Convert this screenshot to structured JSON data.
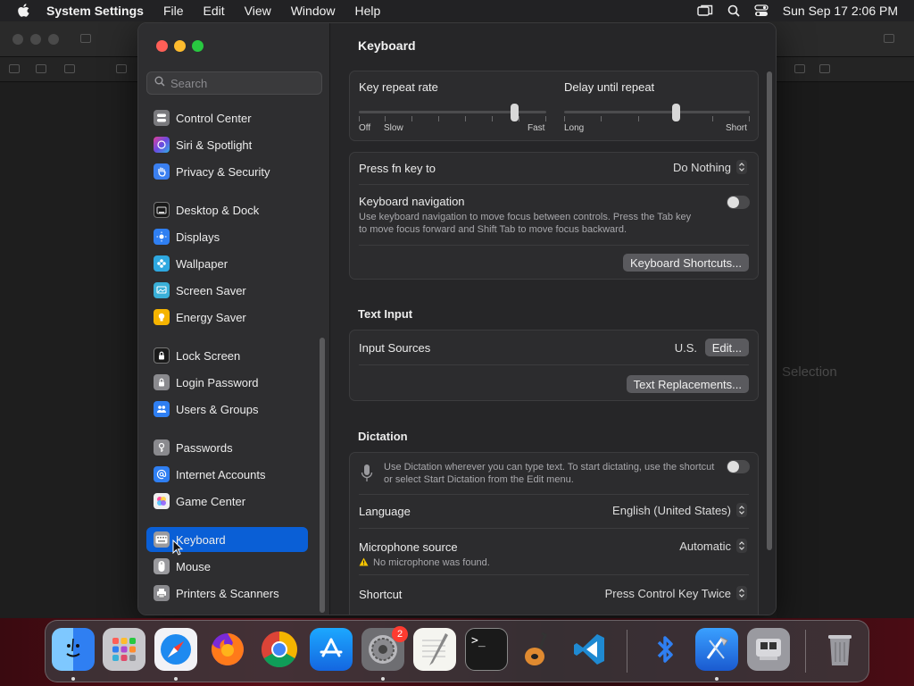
{
  "menubar": {
    "app_name": "System Settings",
    "items": [
      "File",
      "Edit",
      "View",
      "Window",
      "Help"
    ],
    "clock": "Sun Sep 17  2:06 PM"
  },
  "background_window": {
    "placeholder": "Selection"
  },
  "sidebar": {
    "search_placeholder": "Search",
    "items": [
      {
        "label": "Control Center",
        "icon": "control-center-icon",
        "color": "#7a7a7e"
      },
      {
        "label": "Siri & Spotlight",
        "icon": "siri-icon",
        "color": "#b04ad0"
      },
      {
        "label": "Privacy & Security",
        "icon": "hand-icon",
        "color": "#3a7ff0"
      },
      {
        "label": "Desktop & Dock",
        "icon": "dock-icon",
        "color": "#1a1a1a"
      },
      {
        "label": "Displays",
        "icon": "sun-icon",
        "color": "#2f7ff2"
      },
      {
        "label": "Wallpaper",
        "icon": "flower-icon",
        "color": "#2ea8e0"
      },
      {
        "label": "Screen Saver",
        "icon": "screen-saver-icon",
        "color": "#3ab0d8"
      },
      {
        "label": "Energy Saver",
        "icon": "bulb-icon",
        "color": "#f5b400"
      },
      {
        "label": "Lock Screen",
        "icon": "lock-icon",
        "color": "#1a1a1a"
      },
      {
        "label": "Login Password",
        "icon": "padlock-icon",
        "color": "#8a8a8e"
      },
      {
        "label": "Users & Groups",
        "icon": "users-icon",
        "color": "#2f7ff2"
      },
      {
        "label": "Passwords",
        "icon": "key-icon",
        "color": "#8a8a8e"
      },
      {
        "label": "Internet Accounts",
        "icon": "at-icon",
        "color": "#2f7ff2"
      },
      {
        "label": "Game Center",
        "icon": "game-center-icon",
        "color": "#f0f0f0"
      },
      {
        "label": "Keyboard",
        "icon": "keyboard-icon",
        "color": "#9a9a9e"
      },
      {
        "label": "Mouse",
        "icon": "mouse-icon",
        "color": "#9a9a9e"
      },
      {
        "label": "Printers & Scanners",
        "icon": "printer-icon",
        "color": "#8a8a8e"
      }
    ]
  },
  "content": {
    "title": "Keyboard",
    "key_repeat": {
      "label": "Key repeat rate",
      "left_labels": [
        "Off",
        "Slow"
      ],
      "right_label": "Fast",
      "level": 0.83
    },
    "delay_repeat": {
      "label": "Delay until repeat",
      "left_label": "Long",
      "right_label": "Short",
      "level": 0.6
    },
    "fn_key": {
      "label": "Press fn key to",
      "value": "Do Nothing"
    },
    "keyboard_navigation": {
      "label": "Keyboard navigation",
      "description_line1": "Use keyboard navigation to move focus between controls. Press the Tab key",
      "description_line2": "to move focus forward and Shift Tab to move focus backward.",
      "enabled": false
    },
    "keyboard_shortcuts_button": "Keyboard Shortcuts...",
    "text_input": {
      "section_title": "Text Input",
      "input_sources_label": "Input Sources",
      "input_sources_value": "U.S.",
      "edit_button": "Edit...",
      "text_replacements_button": "Text Replacements..."
    },
    "dictation": {
      "section_title": "Dictation",
      "description_line1": "Use Dictation wherever you can type text. To start dictating, use the shortcut",
      "description_line2": "or select Start Dictation from the Edit menu.",
      "enabled": false,
      "language_label": "Language",
      "language_value": "English (United States)",
      "mic_label": "Microphone source",
      "mic_value": "Automatic",
      "mic_warning": "No microphone was found.",
      "shortcut_label": "Shortcut",
      "shortcut_value": "Press Control Key Twice"
    }
  },
  "dock": {
    "apps": [
      {
        "name": "finder-icon"
      },
      {
        "name": "launchpad-icon"
      },
      {
        "name": "safari-icon"
      },
      {
        "name": "firefox-icon"
      },
      {
        "name": "chrome-icon"
      },
      {
        "name": "app-store-icon"
      },
      {
        "name": "system-settings-icon",
        "badge": "2"
      },
      {
        "name": "textedit-icon"
      },
      {
        "name": "terminal-icon"
      },
      {
        "name": "garageband-icon"
      },
      {
        "name": "vscode-icon"
      },
      {
        "name": "bluetooth-icon"
      },
      {
        "name": "xcode-icon"
      },
      {
        "name": "boot-camp-icon"
      },
      {
        "name": "trash-icon"
      }
    ]
  }
}
